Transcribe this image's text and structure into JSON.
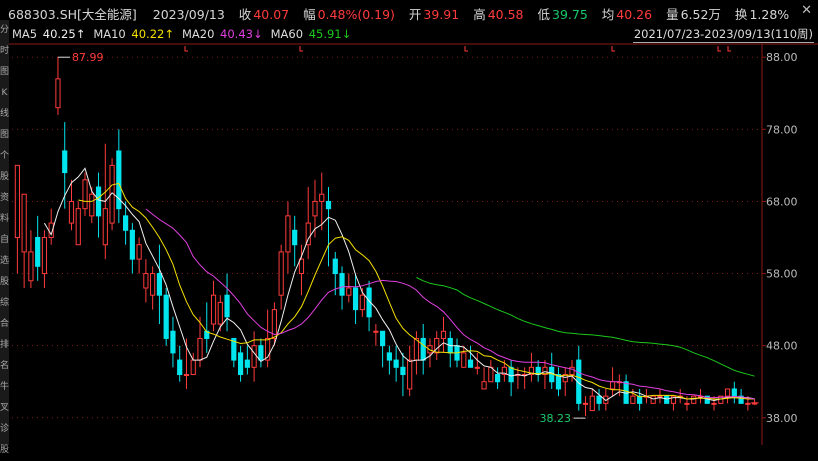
{
  "header": {
    "symbol": "688303.SH[大全能源]",
    "date": "2023/09/13",
    "close_label": "收",
    "close": "40.07",
    "change_label": "幅",
    "change": "0.48%(0.19)",
    "open_label": "开",
    "open": "39.91",
    "high_label": "高",
    "high": "40.58",
    "low_label": "低",
    "low": "39.75",
    "avg_label": "均",
    "avg": "40.26",
    "volume_label": "量",
    "volume": "6.52万",
    "turnover_label": "换",
    "turnover": "1.28%",
    "close_icon": "close-icon"
  },
  "ma_legend": [
    {
      "label": "MA5",
      "value": "40.25↑",
      "color": "#f0f0f0"
    },
    {
      "label": "MA10",
      "value": "40.22↑",
      "color": "#f5e000"
    },
    {
      "label": "MA20",
      "value": "40.43↓",
      "color": "#e040e0"
    },
    {
      "label": "MA60",
      "value": "45.91↓",
      "color": "#1cc81c"
    }
  ],
  "date_range": "2021/07/23-2023/09/13(110周)",
  "side_labels": [
    "分",
    "时",
    "图",
    "K",
    "线",
    "图",
    "个",
    "股",
    "资",
    "料",
    "自",
    "选",
    "股",
    "综",
    "合",
    "排",
    "名",
    "牛",
    "叉",
    "诊",
    "股"
  ],
  "colors": {
    "up": "#ff3b3b",
    "down": "#00e5ee",
    "ma5": "#f0f0f0",
    "ma10": "#f5e000",
    "ma20": "#e040e0",
    "ma60": "#1cc81c",
    "grid": "#7a1a1a"
  },
  "chart_data": {
    "type": "candlestick",
    "period": "weekly",
    "ylim": [
      37,
      89
    ],
    "y_ticks": [
      "88.00",
      "78.00",
      "68.00",
      "58.00",
      "48.00",
      "38.00"
    ],
    "annotations": [
      {
        "text": "87.99",
        "type": "max"
      },
      {
        "text": "38.23",
        "type": "min"
      }
    ],
    "candles": [
      [
        63,
        73,
        73,
        58
      ],
      [
        61,
        69,
        69,
        56
      ],
      [
        57,
        61,
        64,
        56
      ],
      [
        63,
        59,
        66,
        57
      ],
      [
        58,
        63,
        64,
        56
      ],
      [
        63,
        65,
        67,
        62
      ],
      [
        81,
        85,
        88,
        80
      ],
      [
        75,
        72,
        79,
        67
      ],
      [
        65,
        68,
        71,
        64
      ],
      [
        62,
        67,
        68,
        63
      ],
      [
        67,
        71,
        72,
        66
      ],
      [
        66,
        69,
        70,
        65
      ],
      [
        70,
        66,
        72,
        63
      ],
      [
        62,
        67,
        76,
        60
      ],
      [
        65,
        73,
        74,
        64
      ],
      [
        75,
        67,
        78,
        65
      ],
      [
        66,
        64,
        68,
        62
      ],
      [
        64,
        60,
        65,
        58
      ],
      [
        60,
        62,
        63,
        58
      ],
      [
        56,
        58,
        60,
        54
      ],
      [
        55,
        58,
        59,
        53
      ],
      [
        58,
        55,
        62,
        51
      ],
      [
        55,
        49,
        56,
        48
      ],
      [
        50,
        47,
        52,
        45
      ],
      [
        46,
        44,
        48,
        43
      ],
      [
        44,
        44,
        49,
        42
      ],
      [
        44,
        46,
        47,
        44
      ],
      [
        46,
        49,
        52,
        45
      ],
      [
        50,
        49,
        54,
        47
      ],
      [
        51,
        55,
        57,
        50
      ],
      [
        51,
        54,
        55,
        50
      ],
      [
        55,
        52,
        58,
        50
      ],
      [
        49,
        46,
        49,
        45
      ],
      [
        47,
        44,
        48,
        43
      ],
      [
        46,
        45,
        48,
        44
      ],
      [
        45,
        48,
        50,
        43
      ],
      [
        48,
        46,
        49,
        45
      ],
      [
        46,
        49,
        53,
        45
      ],
      [
        49,
        53,
        54,
        48
      ],
      [
        55,
        61,
        62,
        53
      ],
      [
        61,
        66,
        68,
        58
      ],
      [
        64,
        62,
        66,
        59
      ],
      [
        58,
        60,
        62,
        55
      ],
      [
        62,
        65,
        70,
        60
      ],
      [
        66,
        68,
        71,
        63
      ],
      [
        68,
        69,
        72,
        64
      ],
      [
        68,
        67,
        70,
        59
      ],
      [
        60,
        58,
        61,
        55
      ],
      [
        58,
        55,
        59,
        53
      ],
      [
        55,
        56,
        58,
        54
      ],
      [
        56,
        53,
        58,
        51
      ],
      [
        53,
        55,
        56,
        52
      ],
      [
        56,
        52,
        57,
        50
      ],
      [
        50,
        50,
        51,
        48
      ],
      [
        50,
        48,
        50,
        45
      ],
      [
        47,
        46,
        48,
        44
      ],
      [
        46,
        45,
        48,
        43
      ],
      [
        45,
        44,
        47,
        41
      ],
      [
        42,
        46,
        48,
        41
      ],
      [
        46,
        49,
        50,
        44
      ],
      [
        49,
        46,
        51,
        44
      ],
      [
        47,
        48,
        49,
        45
      ],
      [
        47,
        49,
        50,
        46
      ],
      [
        49,
        50,
        52,
        47
      ],
      [
        49,
        47,
        50,
        45
      ],
      [
        48,
        46,
        49,
        45
      ],
      [
        45,
        47,
        48,
        45
      ],
      [
        46,
        45,
        48,
        45
      ],
      [
        45,
        45,
        47,
        44
      ],
      [
        42,
        43,
        45,
        42
      ],
      [
        43,
        45,
        46,
        43
      ],
      [
        44,
        43,
        45,
        42
      ],
      [
        44,
        45,
        46,
        43
      ],
      [
        45,
        43,
        46,
        41
      ],
      [
        44,
        44,
        45,
        42
      ],
      [
        44,
        44,
        45,
        42
      ],
      [
        44,
        45,
        47,
        43
      ],
      [
        45,
        44,
        46,
        43
      ],
      [
        44,
        45,
        46,
        42
      ],
      [
        45,
        43,
        47,
        42
      ],
      [
        44,
        42,
        45,
        41
      ],
      [
        43,
        44,
        45,
        41
      ],
      [
        44,
        45,
        46,
        43
      ],
      [
        46,
        40,
        48,
        39
      ],
      [
        40,
        40,
        41,
        38.23
      ],
      [
        39,
        41,
        42,
        39
      ],
      [
        41,
        40,
        42,
        39
      ],
      [
        40,
        41,
        42,
        39
      ],
      [
        42,
        43,
        45,
        41
      ],
      [
        43,
        43,
        44,
        41
      ],
      [
        43,
        40,
        44,
        40
      ],
      [
        40,
        41,
        42,
        40
      ],
      [
        41,
        40,
        42,
        39
      ],
      [
        41,
        41,
        42,
        40
      ],
      [
        40,
        41,
        41,
        40
      ],
      [
        41,
        41,
        42,
        40
      ],
      [
        41,
        40,
        41,
        40
      ],
      [
        40,
        41,
        41,
        39
      ],
      [
        41,
        41,
        42,
        40
      ],
      [
        40,
        40,
        41,
        39
      ],
      [
        40,
        41,
        41,
        40
      ],
      [
        41,
        41,
        42,
        40
      ],
      [
        41,
        40,
        41,
        40
      ],
      [
        40,
        40,
        41,
        39
      ],
      [
        40,
        41,
        41,
        40
      ],
      [
        41,
        42,
        42,
        40
      ],
      [
        42,
        41,
        43,
        40
      ],
      [
        41,
        40,
        42,
        40
      ],
      [
        40,
        40,
        41,
        39
      ],
      [
        39.91,
        40.07,
        40.58,
        39.75
      ]
    ]
  }
}
